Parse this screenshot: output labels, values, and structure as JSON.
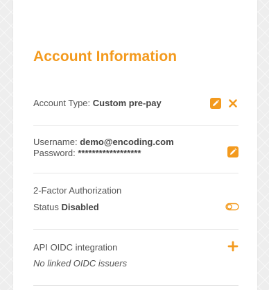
{
  "section_title": "Account Information",
  "account_type": {
    "label": "Account Type:",
    "value": "Custom pre-pay"
  },
  "credentials": {
    "username_label": "Username:",
    "username_value": "demo@encoding.com",
    "password_label": "Password:",
    "password_value": "******************"
  },
  "two_factor": {
    "title": "2-Factor Authorization",
    "status_label": "Status",
    "status_value": "Disabled"
  },
  "oidc": {
    "title": "API OIDC integration",
    "empty_text": "No linked OIDC issuers"
  },
  "colors": {
    "accent": "#f39a1e",
    "text": "#555555",
    "divider": "#e6e6e6"
  },
  "icons": [
    "edit-icon",
    "close-icon",
    "edit-icon",
    "toggle-off-icon",
    "plus-icon"
  ]
}
